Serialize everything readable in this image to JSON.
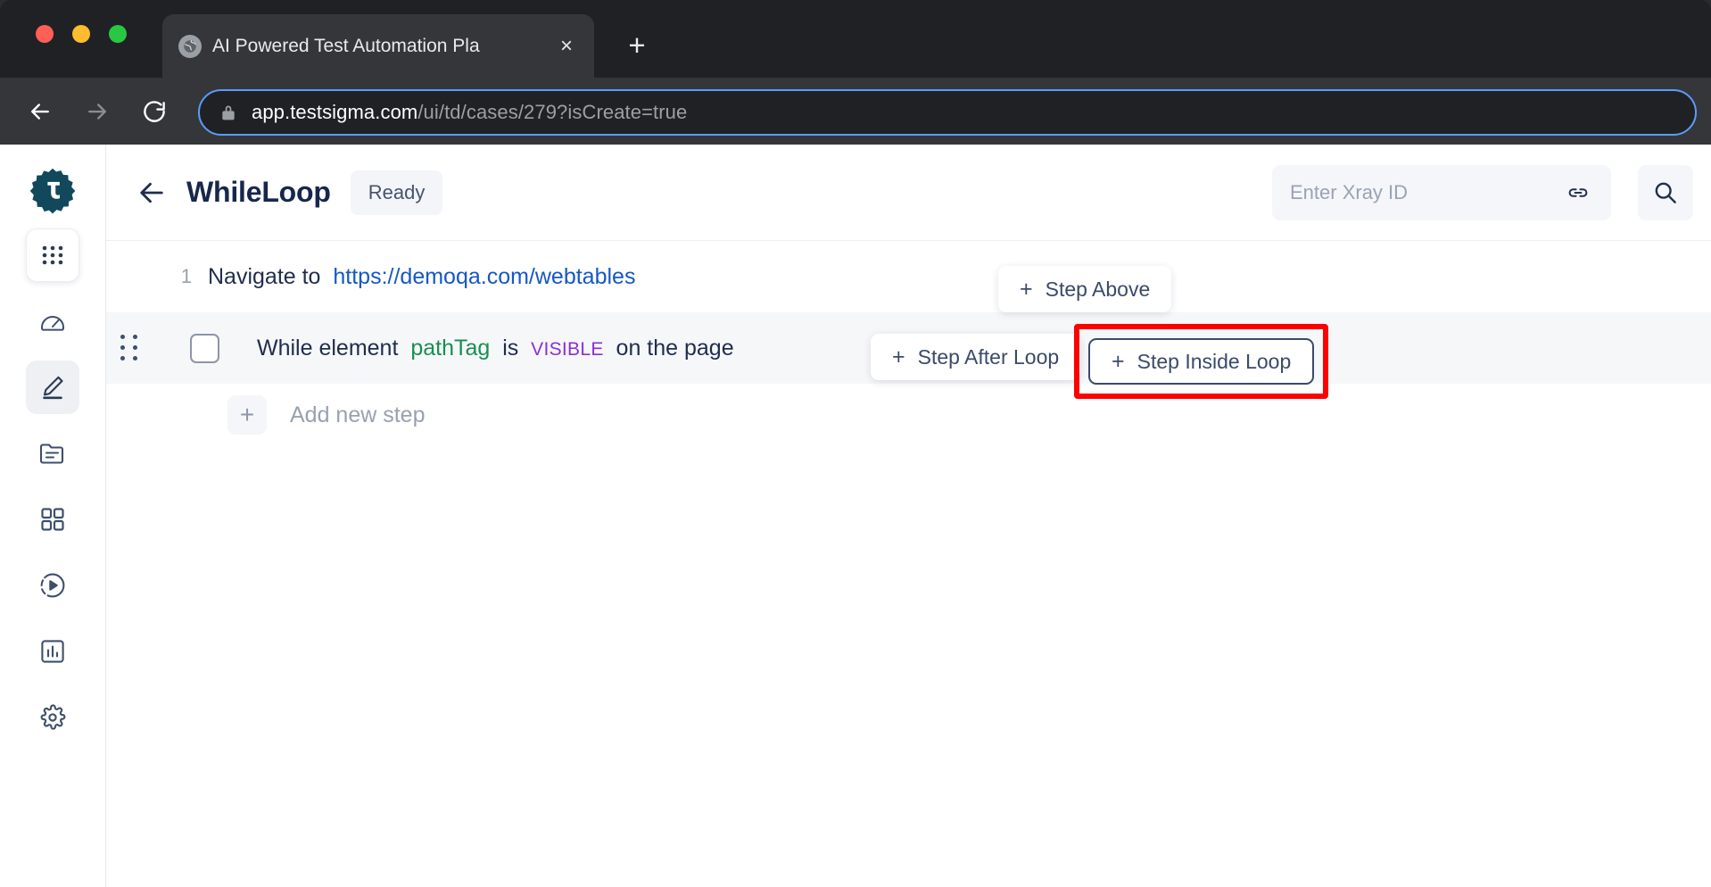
{
  "browser": {
    "tab": {
      "title": "AI Powered Test Automation Pla",
      "favicon": "globe-icon",
      "close": "×"
    },
    "new_tab_label": "+",
    "omnibox": {
      "host": "app.testsigma.com",
      "path": "/ui/td/cases/279?isCreate=true",
      "lock": "lock-icon"
    },
    "nav": {
      "back": "back-arrow-icon",
      "forward": "forward-arrow-icon",
      "reload": "reload-icon"
    }
  },
  "sidebar": {
    "brand": "testsigma-logo",
    "items": [
      {
        "name": "apps-grid-icon",
        "active": false,
        "boxed": true
      },
      {
        "name": "speedometer-icon",
        "active": false,
        "boxed": false
      },
      {
        "name": "pencil-edit-icon",
        "active": true,
        "boxed": false
      },
      {
        "name": "folder-list-icon",
        "active": false,
        "boxed": false
      },
      {
        "name": "grid-squares-icon",
        "active": false,
        "boxed": false
      },
      {
        "name": "play-circle-icon",
        "active": false,
        "boxed": false
      },
      {
        "name": "bar-chart-icon",
        "active": false,
        "boxed": false
      },
      {
        "name": "gear-icon",
        "active": false,
        "boxed": false
      }
    ]
  },
  "header": {
    "back_icon": "back-arrow-icon",
    "title": "WhileLoop",
    "status": "Ready",
    "xray": {
      "placeholder": "Enter Xray ID",
      "value": "",
      "link_icon": "link-icon"
    },
    "search_icon": "search-icon"
  },
  "steps": {
    "rows": [
      {
        "index": "1",
        "prefix": "Navigate to",
        "link": "https://demoqa.com/webtables"
      },
      {
        "prefix": "While element",
        "element": "pathTag",
        "middle": "is",
        "enum": "VISIBLE",
        "suffix": "on the page"
      }
    ],
    "add_new": {
      "plus": "+",
      "label": "Add new step"
    }
  },
  "actions": {
    "step_above": "Step Above",
    "step_after_loop": "Step After Loop",
    "step_inside_loop": "Step Inside Loop",
    "plus": "+"
  },
  "colors": {
    "highlight": "#ff0000",
    "link": "#1558c4",
    "element_token": "#178f52",
    "enum_token": "#8b2fd6",
    "brand_dark": "#12485c",
    "omnibox_focus": "#5b9bf8"
  }
}
